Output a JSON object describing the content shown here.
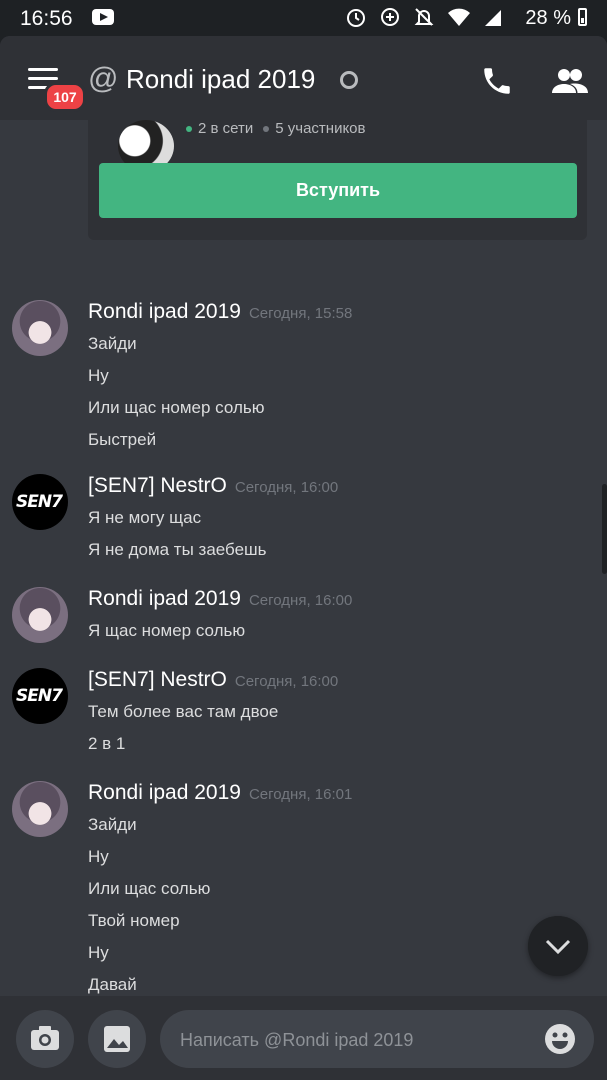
{
  "statusbar": {
    "time": "16:56",
    "battery": "28 %"
  },
  "header": {
    "badge": "107",
    "at_symbol": "@",
    "title": "Rondi ipad 2019"
  },
  "invite": {
    "online": "2 в сети",
    "members": "5 участников",
    "join_label": "Вступить"
  },
  "messages": [
    {
      "author": "Rondi ipad 2019",
      "time": "Сегодня, 15:58",
      "avatar": "anime",
      "lines": [
        "Зайди",
        "Ну",
        "Или щас номер солью",
        "Быстрей"
      ]
    },
    {
      "author": "[SEN7] NestrO",
      "time": "Сегодня, 16:00",
      "avatar": "sen7",
      "lines": [
        "Я не могу щас",
        "Я не дома ты заебешь"
      ]
    },
    {
      "author": "Rondi ipad 2019",
      "time": "Сегодня, 16:00",
      "avatar": "anime",
      "lines": [
        "Я щас номер солью"
      ]
    },
    {
      "author": "[SEN7] NestrO",
      "time": "Сегодня, 16:00",
      "avatar": "sen7",
      "lines": [
        "Тем более вас там двое",
        "2 в 1"
      ]
    },
    {
      "author": "Rondi ipad 2019",
      "time": "Сегодня, 16:01",
      "avatar": "anime",
      "lines": [
        "Зайди",
        "Ну",
        "Или щас солью",
        "Твой номер",
        "Ну",
        "Давай"
      ]
    }
  ],
  "avatar_logo_text": "SEN7",
  "composer": {
    "placeholder": "Написать @Rondi ipad 2019"
  },
  "icons": {
    "menu": "menu-icon",
    "phone": "phone-icon",
    "members": "members-icon",
    "camera": "camera-icon",
    "gallery": "image-icon",
    "emoji": "emoji-icon",
    "jump": "chevron-down-icon"
  },
  "colors": {
    "accent_green": "#43b581",
    "badge_red": "#ed4245",
    "background": "#36393f",
    "header": "#2f3136"
  }
}
